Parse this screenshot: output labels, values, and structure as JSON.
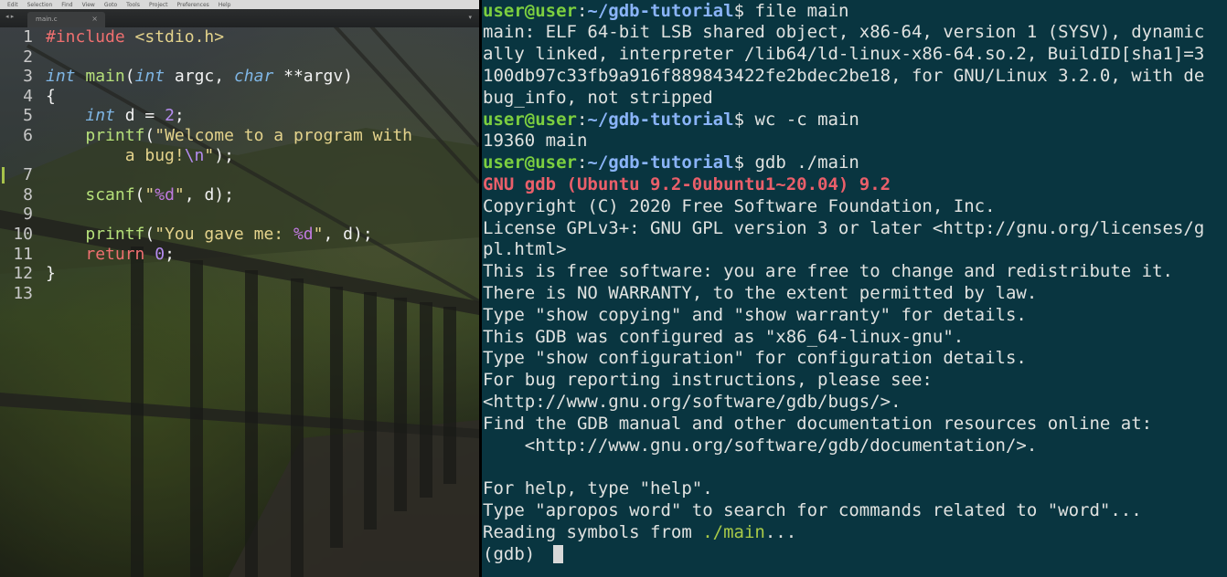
{
  "editor": {
    "menu": [
      "Edit",
      "Selection",
      "Find",
      "View",
      "Goto",
      "Tools",
      "Project",
      "Preferences",
      "Help"
    ],
    "tab_title": "main.c",
    "tab_close": "×",
    "tab_nav": "◂ ▸",
    "tab_dropdown": "▾",
    "lines": [
      {
        "n": "1",
        "t": [
          [
            "kw",
            "#include"
          ],
          [
            "",
            " "
          ],
          [
            "str",
            "<stdio.h>"
          ]
        ]
      },
      {
        "n": "2",
        "t": []
      },
      {
        "n": "3",
        "t": [
          [
            "typ",
            "int"
          ],
          [
            "",
            " "
          ],
          [
            "fn",
            "main"
          ],
          [
            "",
            "("
          ],
          [
            "typ",
            "int"
          ],
          [
            "",
            " argc, "
          ],
          [
            "typ",
            "char"
          ],
          [
            "",
            " **argv)"
          ]
        ]
      },
      {
        "n": "4",
        "t": [
          [
            "",
            "{"
          ]
        ]
      },
      {
        "n": "5",
        "t": [
          [
            "",
            "    "
          ],
          [
            "typ",
            "int"
          ],
          [
            "",
            " d = "
          ],
          [
            "num",
            "2"
          ],
          [
            "",
            ";"
          ]
        ]
      },
      {
        "n": "6",
        "wrapped": true,
        "t": [
          [
            "",
            "    "
          ],
          [
            "fn",
            "printf"
          ],
          [
            "",
            "("
          ],
          [
            "str",
            "\"Welcome to a program with\n        a bug!"
          ],
          [
            "esc",
            "\\n"
          ],
          [
            "str",
            "\""
          ],
          [
            "",
            ");"
          ]
        ]
      },
      {
        "n": "7",
        "mark": true,
        "t": []
      },
      {
        "n": "8",
        "t": [
          [
            "",
            "    "
          ],
          [
            "fn",
            "scanf"
          ],
          [
            "",
            "("
          ],
          [
            "str",
            "\""
          ],
          [
            "fmt",
            "%d"
          ],
          [
            "str",
            "\""
          ],
          [
            "",
            ", d);"
          ]
        ]
      },
      {
        "n": "9",
        "t": []
      },
      {
        "n": "10",
        "t": [
          [
            "",
            "    "
          ],
          [
            "fn",
            "printf"
          ],
          [
            "",
            "("
          ],
          [
            "str",
            "\"You gave me: "
          ],
          [
            "fmt",
            "%d"
          ],
          [
            "str",
            "\""
          ],
          [
            "",
            ", d);"
          ]
        ]
      },
      {
        "n": "11",
        "t": [
          [
            "",
            "    "
          ],
          [
            "kw",
            "return"
          ],
          [
            "",
            " "
          ],
          [
            "num",
            "0"
          ],
          [
            "",
            ";"
          ]
        ]
      },
      {
        "n": "12",
        "t": [
          [
            "",
            "}"
          ]
        ]
      },
      {
        "n": "13",
        "t": []
      }
    ]
  },
  "terminal": {
    "lines": [
      [
        [
          "prompt-user",
          "user@user"
        ],
        [
          "",
          ":"
        ],
        [
          "prompt-path",
          "~/gdb-tutorial"
        ],
        [
          "",
          "$ file main"
        ]
      ],
      [
        [
          "",
          "main: ELF 64-bit LSB shared object, x86-64, version 1 (SYSV), dynamic"
        ]
      ],
      [
        [
          "",
          "ally linked, interpreter /lib64/ld-linux-x86-64.so.2, BuildID[sha1]=3"
        ]
      ],
      [
        [
          "",
          "100db97c33fb9a916f889843422fe2bdec2be18, for GNU/Linux 3.2.0, with de"
        ]
      ],
      [
        [
          "",
          "bug_info, not stripped"
        ]
      ],
      [
        [
          "prompt-user",
          "user@user"
        ],
        [
          "",
          ":"
        ],
        [
          "prompt-path",
          "~/gdb-tutorial"
        ],
        [
          "",
          "$ wc -c main"
        ]
      ],
      [
        [
          "",
          "19360 main"
        ]
      ],
      [
        [
          "prompt-user",
          "user@user"
        ],
        [
          "",
          ":"
        ],
        [
          "prompt-path",
          "~/gdb-tutorial"
        ],
        [
          "",
          "$ gdb ./main"
        ]
      ],
      [
        [
          "gdb-ver",
          "GNU gdb (Ubuntu 9.2-0ubuntu1~20.04) 9.2"
        ]
      ],
      [
        [
          "",
          "Copyright (C) 2020 Free Software Foundation, Inc."
        ]
      ],
      [
        [
          "",
          "License GPLv3+: GNU GPL version 3 or later <http://gnu.org/licenses/g"
        ]
      ],
      [
        [
          "",
          "pl.html>"
        ]
      ],
      [
        [
          "",
          "This is free software: you are free to change and redistribute it."
        ]
      ],
      [
        [
          "",
          "There is NO WARRANTY, to the extent permitted by law."
        ]
      ],
      [
        [
          "",
          "Type \"show copying\" and \"show warranty\" for details."
        ]
      ],
      [
        [
          "",
          "This GDB was configured as \"x86_64-linux-gnu\"."
        ]
      ],
      [
        [
          "",
          "Type \"show configuration\" for configuration details."
        ]
      ],
      [
        [
          "",
          "For bug reporting instructions, please see:"
        ]
      ],
      [
        [
          "",
          "<http://www.gnu.org/software/gdb/bugs/>."
        ]
      ],
      [
        [
          "",
          "Find the GDB manual and other documentation resources online at:"
        ]
      ],
      [
        [
          "",
          "    <http://www.gnu.org/software/gdb/documentation/>."
        ]
      ],
      [
        [
          "",
          ""
        ]
      ],
      [
        [
          "",
          "For help, type \"help\"."
        ]
      ],
      [
        [
          "",
          "Type \"apropos word\" to search for commands related to \"word\"..."
        ]
      ],
      [
        [
          "",
          "Reading symbols from "
        ],
        [
          "path-hl",
          "./main"
        ],
        [
          "",
          "..."
        ]
      ],
      [
        [
          "",
          "(gdb) "
        ]
      ]
    ],
    "cursor": true
  }
}
